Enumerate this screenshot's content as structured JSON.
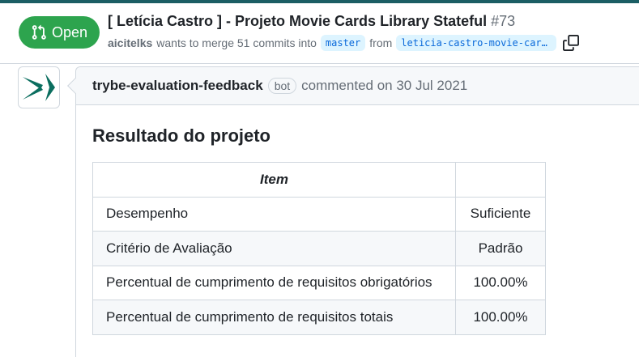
{
  "pr": {
    "state": "Open",
    "title": "[ Letícia Castro ] - Projeto Movie Cards Library Stateful",
    "number": "#73",
    "author": "aicitelks",
    "merge_text": "wants to merge 51 commits into",
    "base_branch": "master",
    "from_text": "from",
    "head_branch": "leticia-castro-movie-cards-library-stateful"
  },
  "comment": {
    "author": "trybe-evaluation-feedback",
    "badge": "bot",
    "meta": "commented on 30 Jul 2021",
    "heading": "Resultado do projeto",
    "table": {
      "headers": [
        "Item",
        ""
      ],
      "rows": [
        [
          "Desempenho",
          "Suficiente"
        ],
        [
          "Critério de Avaliação",
          "Padrão"
        ],
        [
          "Percentual de cumprimento de requisitos obrigatórios",
          "100.00%"
        ],
        [
          "Percentual de cumprimento de requisitos totais",
          "100.00%"
        ]
      ]
    }
  },
  "colors": {
    "open_green": "#2da44e",
    "accent_teal": "#1b5e64",
    "branch_bg": "#ddf4ff",
    "branch_text": "#0969da"
  },
  "icons": {
    "state": "git-pull-request-icon",
    "copy": "copy-icon",
    "avatar": "trybe-logo"
  }
}
